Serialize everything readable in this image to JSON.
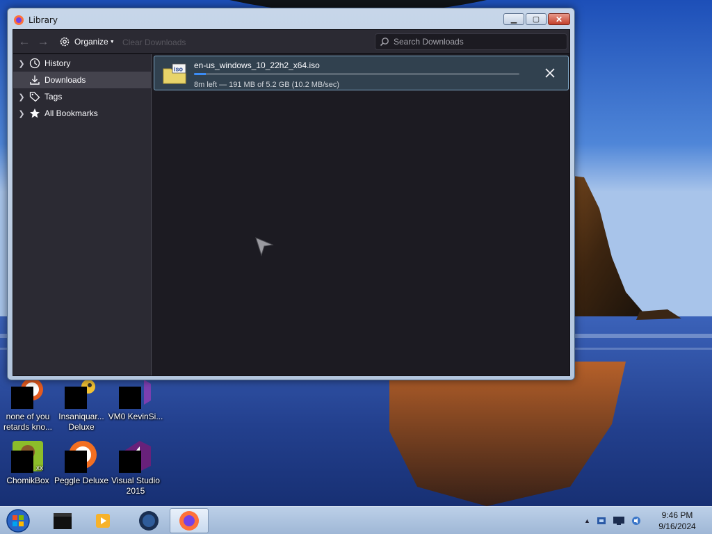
{
  "colors": {
    "window_frame": "#b3c6de",
    "content_bg": "#1c1b22",
    "toolbar_bg": "#2b2a33",
    "accent_progress": "#3b8cf6",
    "selected_row": "#44434d"
  },
  "window": {
    "title": "Library",
    "icon": "firefox-icon",
    "caption_buttons": [
      "minimize-icon",
      "maximize-icon",
      "close-icon"
    ]
  },
  "toolbar": {
    "back_icon": "back-arrow-icon",
    "forward_icon": "forward-arrow-icon",
    "organize_label": "Organize",
    "clear_label": "Clear Downloads",
    "search_placeholder": "Search Downloads"
  },
  "sidebar": {
    "items": [
      {
        "label": "History",
        "icon": "clock-icon",
        "expandable": true,
        "selected": false
      },
      {
        "label": "Downloads",
        "icon": "download-icon",
        "expandable": false,
        "selected": true
      },
      {
        "label": "Tags",
        "icon": "tag-icon",
        "expandable": true,
        "selected": false
      },
      {
        "label": "All Bookmarks",
        "icon": "star-icon",
        "expandable": true,
        "selected": false
      }
    ]
  },
  "downloads": [
    {
      "filename": "en-us_windows_10_22h2_x64.iso",
      "status": "8m left — 191 MB of 5.2 GB (10.2 MB/sec)",
      "progress": 0.036,
      "icon": "iso-file-icon"
    }
  ],
  "desktop_icons": [
    {
      "label": "none of you retards kno...",
      "icon": "ruffle-icon"
    },
    {
      "label": "Insaniquar... Deluxe",
      "icon": "insaniquarium-icon"
    },
    {
      "label": "VM0 KevinSi...",
      "icon": "visual-studio-icon"
    },
    {
      "label": "ChomikBox",
      "icon": "chomikbox-icon"
    },
    {
      "label": "Peggle Deluxe",
      "icon": "peggle-icon"
    },
    {
      "label": "Visual Studio 2015",
      "icon": "visual-studio-icon"
    }
  ],
  "taskbar": {
    "start_icon": "windows-start-icon",
    "apps": [
      "cmd-icon",
      "media-player-icon",
      "globe-icon",
      "firefox-icon"
    ],
    "tray_icons": [
      "show-hidden-icons-chevron",
      "network-icon",
      "display-icon",
      "volume-icon"
    ],
    "time": "9:46 PM",
    "date": "9/16/2024"
  }
}
